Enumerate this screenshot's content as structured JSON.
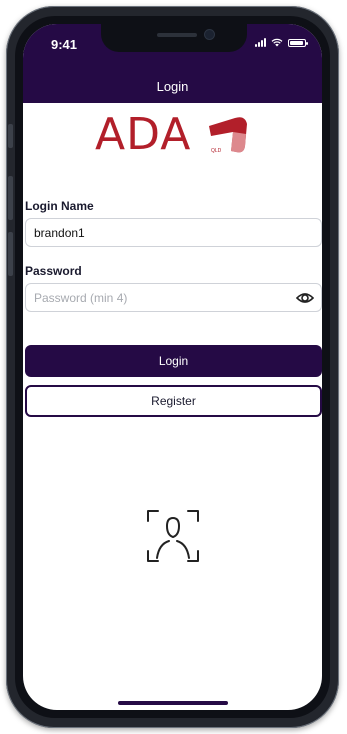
{
  "status_bar": {
    "time": "9:41",
    "icons": [
      "signal-icon",
      "wifi-icon",
      "battery-icon"
    ]
  },
  "nav": {
    "title": "Login"
  },
  "logo": {
    "text": "ADA",
    "mark_icon": "ada-logo-mark"
  },
  "form": {
    "login_name_label": "Login Name",
    "login_name_value": "brandon1",
    "password_label": "Password",
    "password_placeholder": "Password (min 4)",
    "password_value": "",
    "eye_icon": "eye-icon"
  },
  "actions": {
    "login_label": "Login",
    "register_label": "Register"
  },
  "biometric": {
    "icon": "face-id-icon"
  },
  "colors": {
    "primary": "#250a45",
    "logo_red": "#b21f2a",
    "field_border": "#cfd2d8"
  }
}
